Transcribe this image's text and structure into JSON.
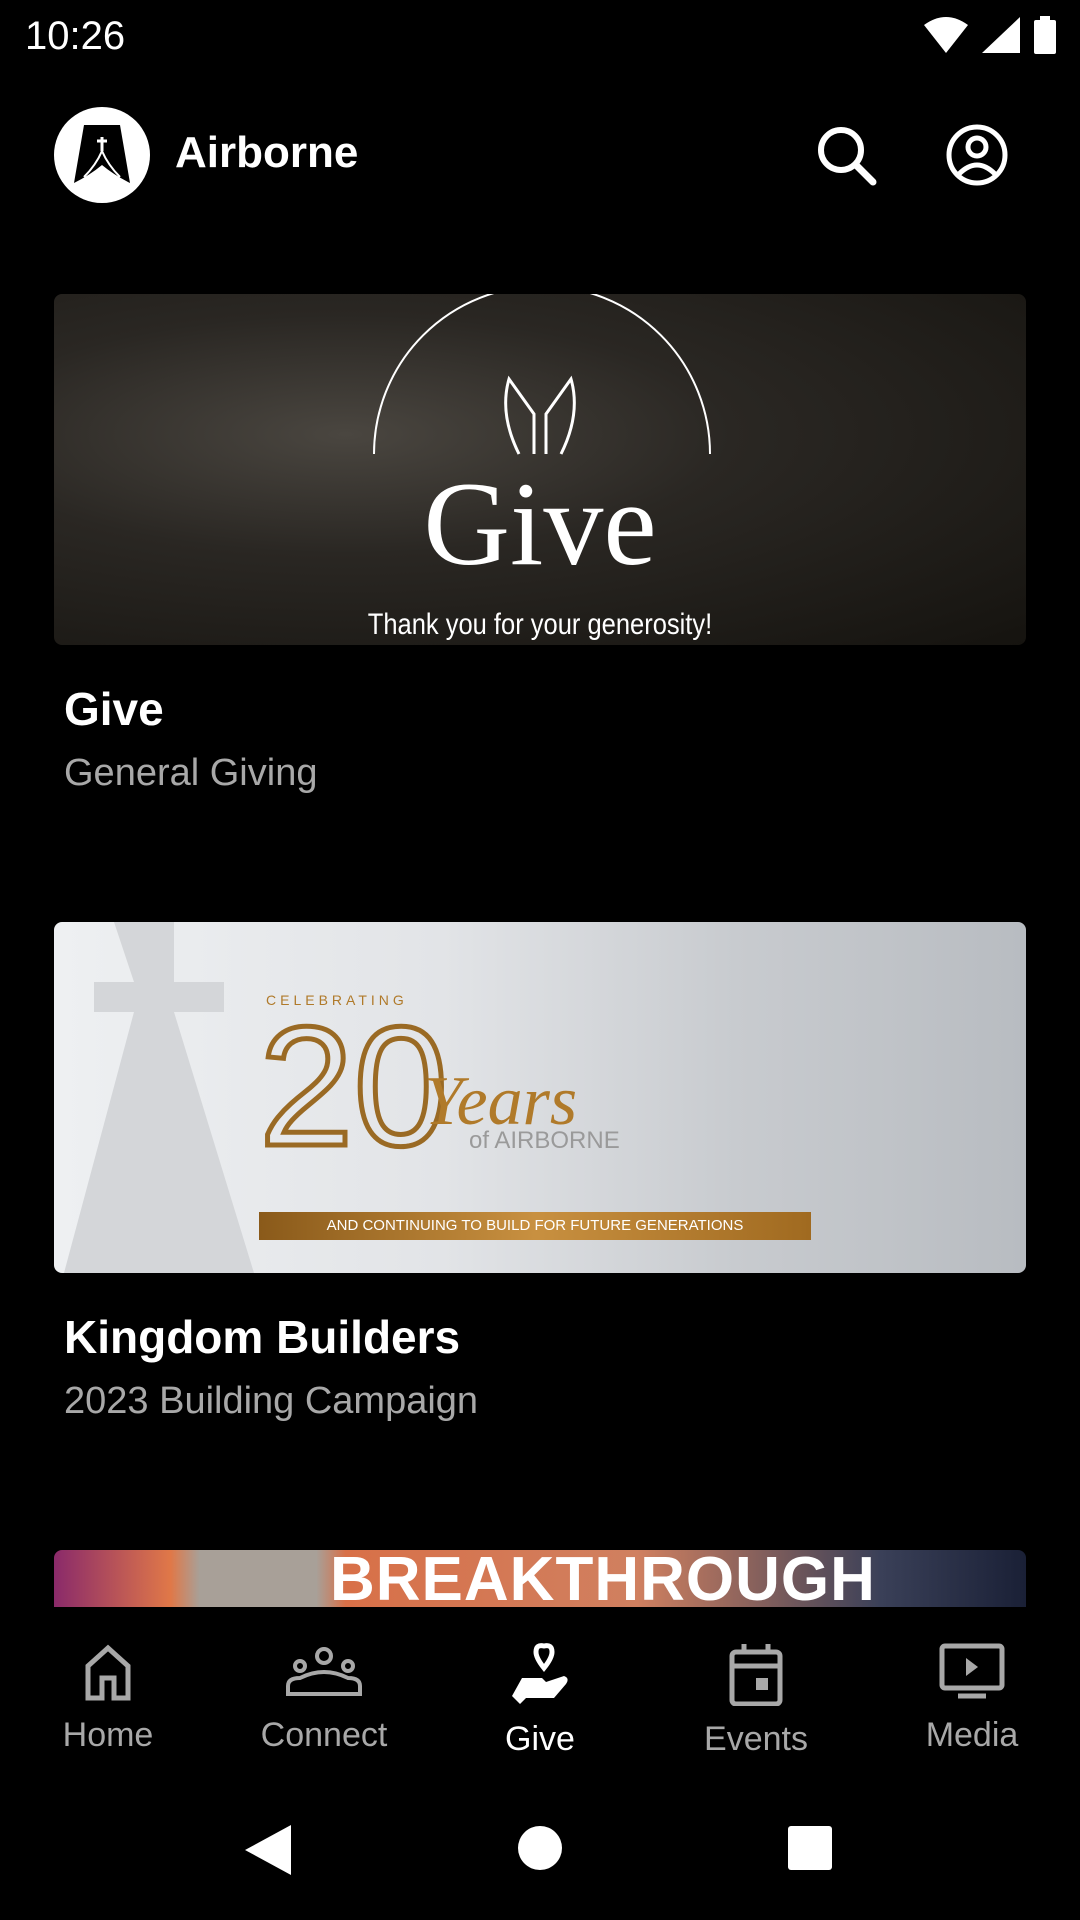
{
  "status_bar": {
    "time": "10:26"
  },
  "header": {
    "title": "Airborne",
    "logo_icon": "airborne-logo",
    "search_icon": "search-icon",
    "account_icon": "account-circle-icon"
  },
  "cards": [
    {
      "title": "Give",
      "subtitle": "General Giving",
      "image": {
        "heading": "Give",
        "tagline": "Thank you for your generosity!"
      }
    },
    {
      "title": "Kingdom Builders",
      "subtitle": "2023 Building Campaign",
      "image": {
        "celebrating": "CELEBRATING",
        "number": "20",
        "years": "Years",
        "of": "of AIRBORNE",
        "banner": "AND CONTINUING TO BUILD FOR FUTURE GENERATIONS"
      }
    },
    {
      "image": {
        "heading": "BREAKTHROUGH"
      }
    }
  ],
  "bottom_nav": {
    "active": "Give",
    "items": [
      {
        "label": "Home",
        "icon": "home-icon"
      },
      {
        "label": "Connect",
        "icon": "groups-icon"
      },
      {
        "label": "Give",
        "icon": "hand-heart-icon"
      },
      {
        "label": "Events",
        "icon": "calendar-icon"
      },
      {
        "label": "Media",
        "icon": "video-play-icon"
      }
    ]
  },
  "colors": {
    "background": "#000000",
    "active": "#ffffff",
    "inactive": "#a8a8a8",
    "gold": "#b07a2a"
  }
}
